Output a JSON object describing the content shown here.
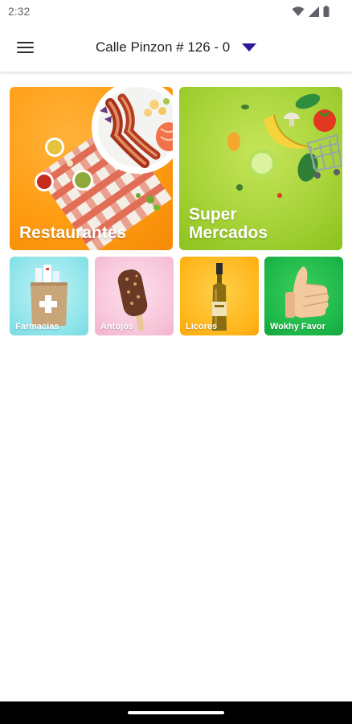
{
  "status_bar": {
    "time": "2:32",
    "icons": [
      "wifi-icon",
      "signal-icon",
      "battery-icon"
    ]
  },
  "app_bar": {
    "menu_icon": "hamburger-menu-icon",
    "address": "Calle Pinzon # 126 - 0",
    "address_caret_icon": "caret-down-icon",
    "caret_color": "#2b1a96"
  },
  "categories": {
    "restaurantes": {
      "label": "Restaurantes",
      "color": "#ff9c12"
    },
    "supermercados": {
      "label": "Super\nMercados",
      "color": "#a8d43a"
    },
    "farmacias": {
      "label": "Farmacias",
      "color": "#8ee4ea"
    },
    "antojos": {
      "label": "Antojos",
      "color": "#f7c4d8"
    },
    "licores": {
      "label": "Licores",
      "color": "#ffb71c"
    },
    "wokhy_favor": {
      "label": "Wokhy Favor",
      "color": "#1eb84a"
    }
  }
}
